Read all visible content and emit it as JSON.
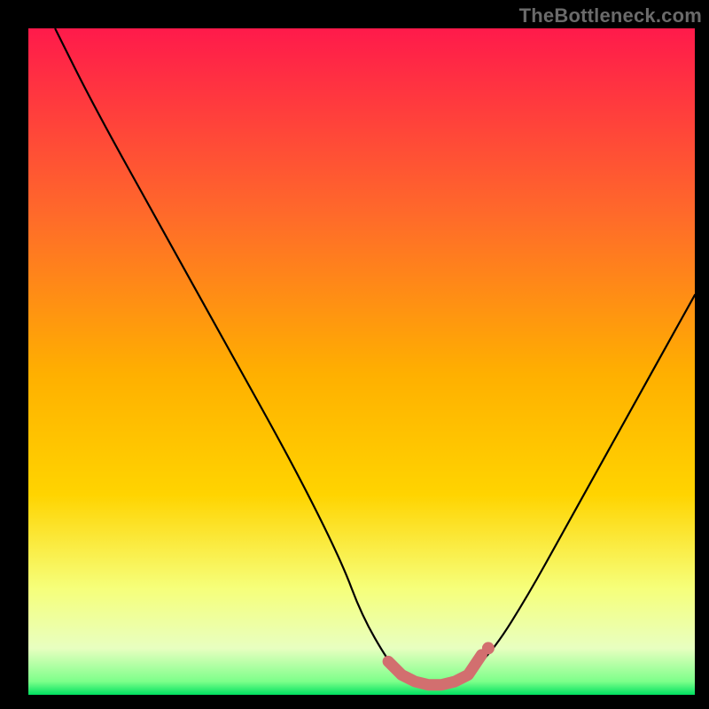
{
  "watermark": "TheBottleneck.com",
  "colors": {
    "bg": "#000000",
    "curve": "#000000",
    "marker": "#d26f6f",
    "gradient_top": "#ff1a4b",
    "gradient_mid_upper": "#ff8a2a",
    "gradient_mid": "#ffd400",
    "gradient_mid_lower": "#f7ff66",
    "gradient_low": "#ecffcf",
    "gradient_bottom": "#00e060"
  },
  "chart_data": {
    "type": "line",
    "title": "",
    "xlabel": "",
    "ylabel": "",
    "xlim": [
      0,
      100
    ],
    "ylim": [
      0,
      100
    ],
    "series": [
      {
        "name": "curve",
        "x": [
          4,
          10,
          20,
          30,
          40,
          47,
          50,
          54,
          56,
          58,
          60,
          62,
          64,
          66,
          70,
          75,
          80,
          85,
          90,
          95,
          100
        ],
        "values": [
          100,
          88,
          70,
          52,
          34,
          20,
          12,
          5,
          3,
          2,
          1.5,
          1.5,
          2,
          3,
          7,
          15,
          24,
          33,
          42,
          51,
          60
        ]
      }
    ],
    "markers": {
      "name": "highlight",
      "x": [
        54,
        56,
        58,
        60,
        62,
        64,
        66,
        68
      ],
      "values": [
        5,
        3,
        2,
        1.5,
        1.5,
        2,
        3,
        6
      ]
    }
  }
}
